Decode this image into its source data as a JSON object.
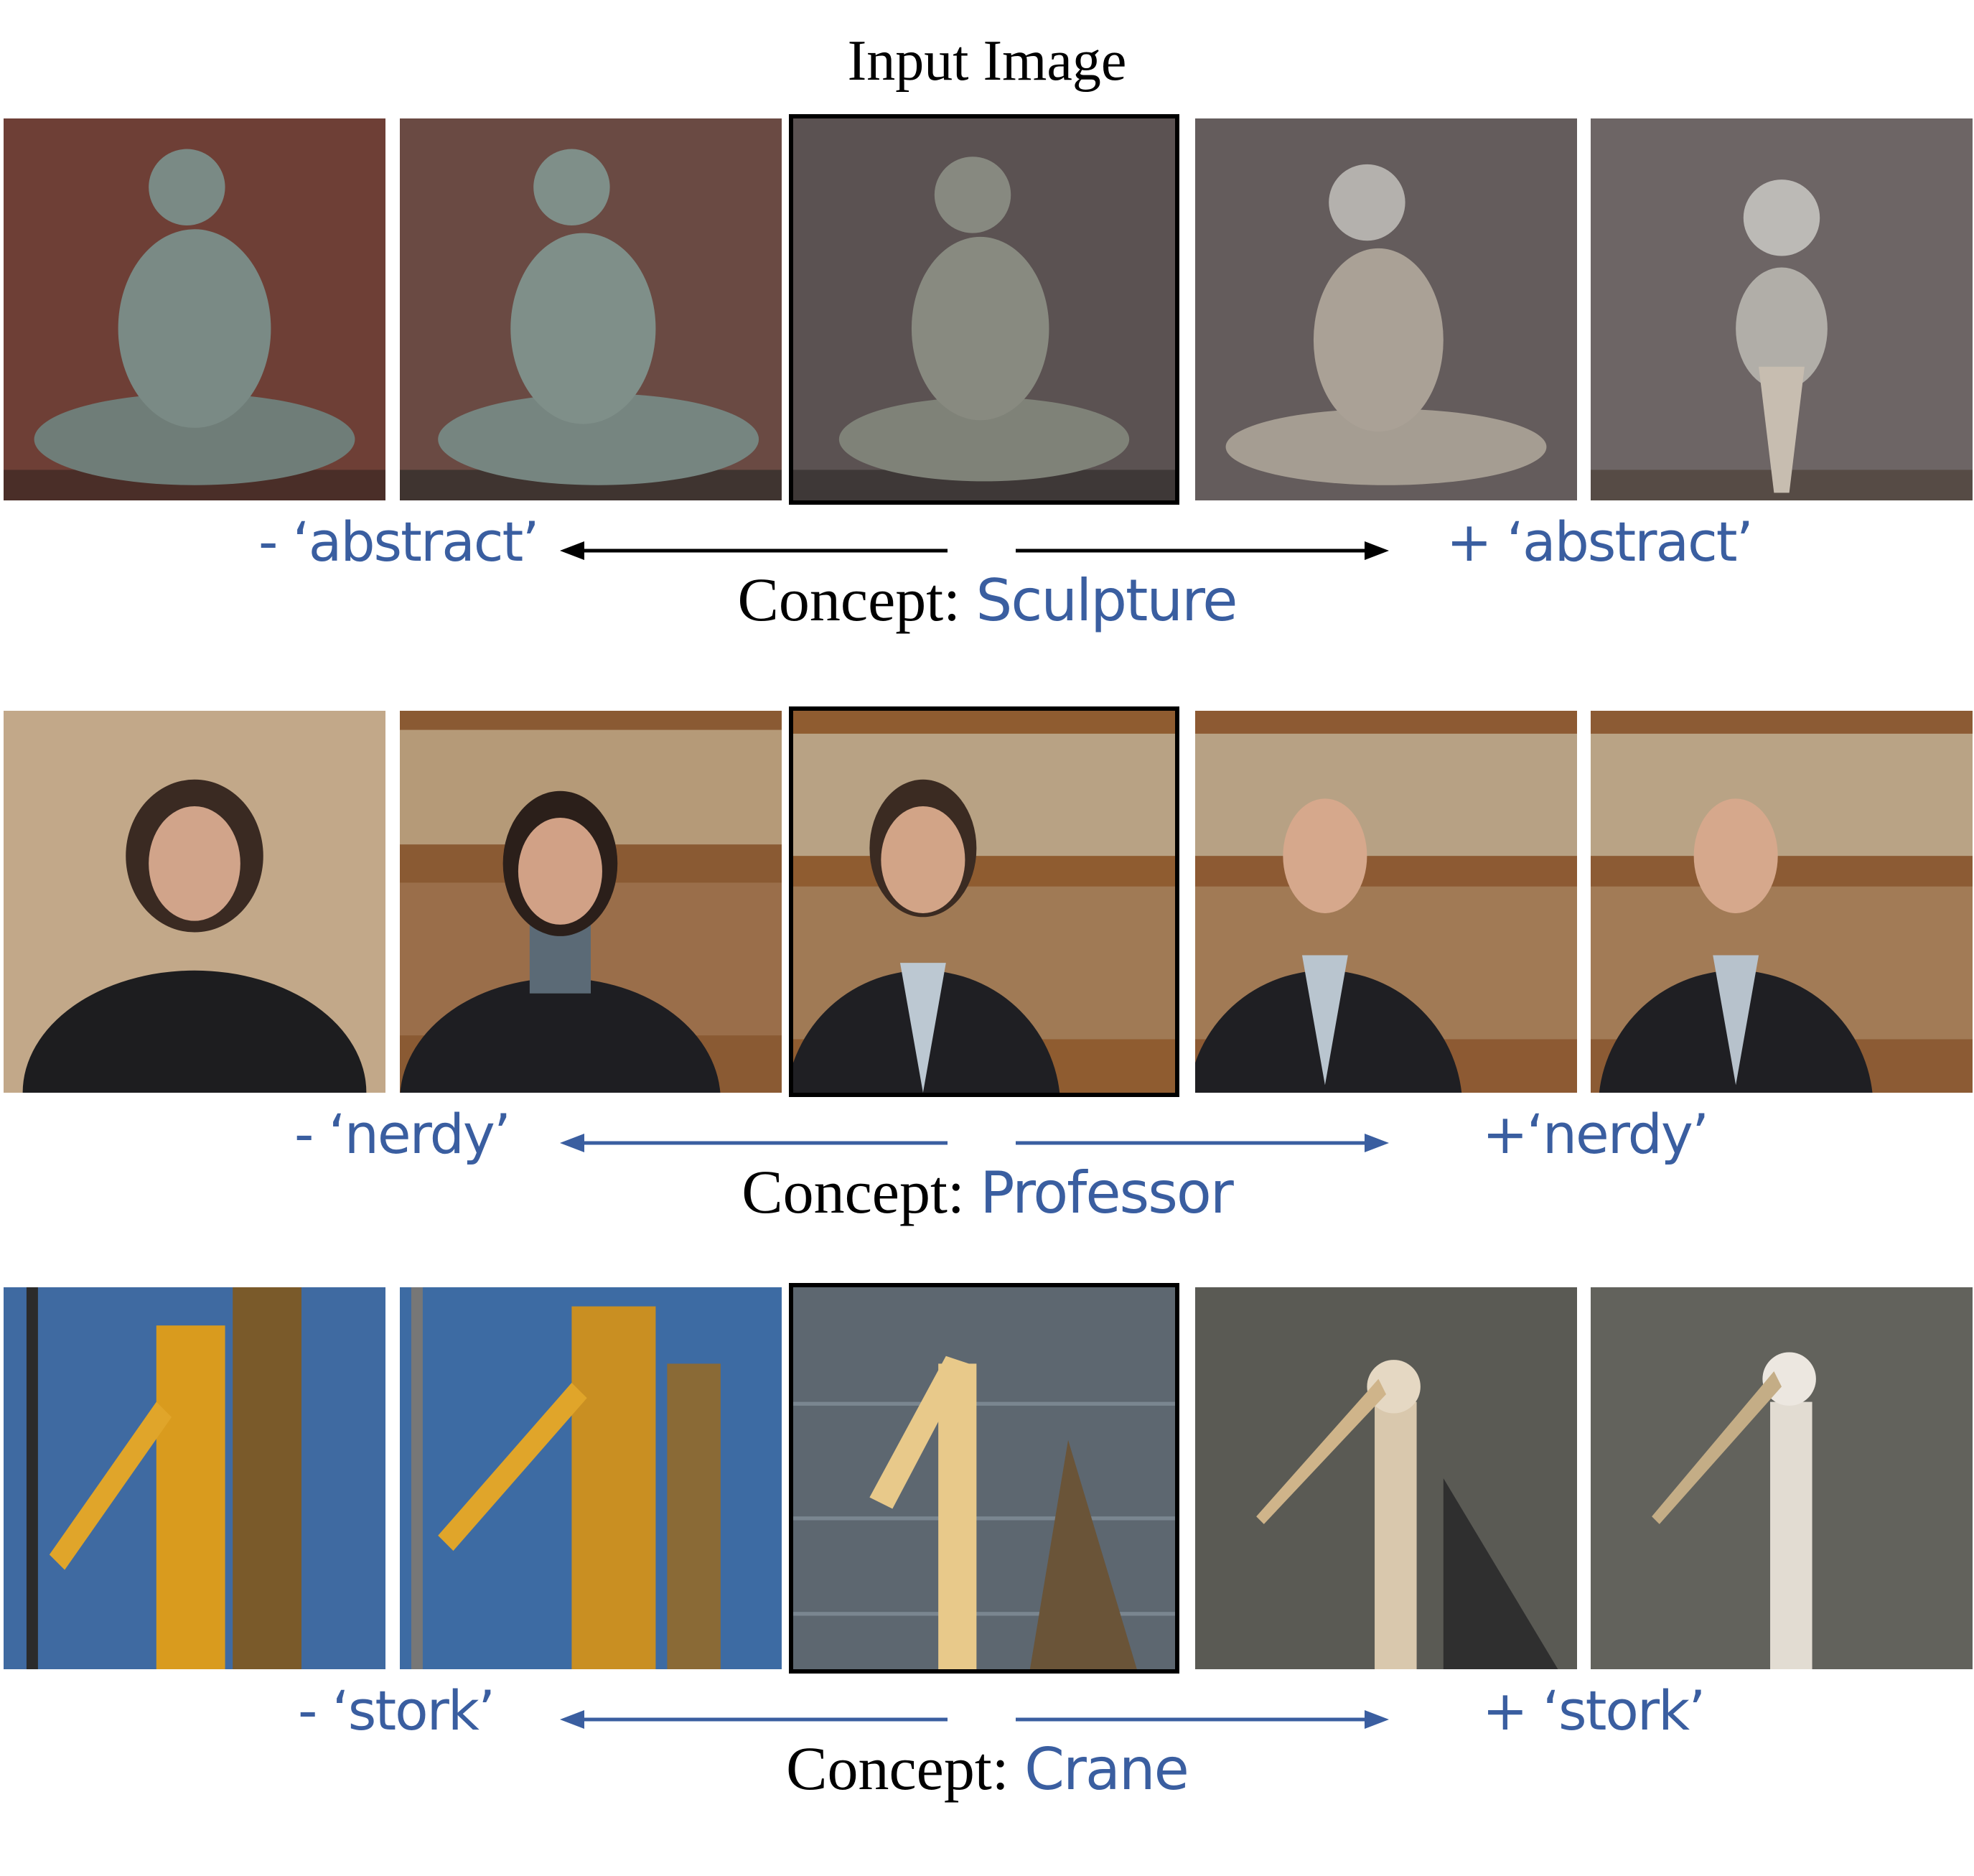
{
  "title": "Input Image",
  "rows": [
    {
      "left_label": "- ‘abstract’",
      "right_label": "+ ‘abstract’",
      "concept_prefix": "Concept:",
      "concept_value": "Sculpture",
      "arrow_color": "#000000"
    },
    {
      "left_label": "- ‘nerdy’",
      "right_label": "+‘nerdy’",
      "concept_prefix": "Concept:",
      "concept_value": "Professor",
      "arrow_color": "#3a5ea0"
    },
    {
      "left_label": "- ‘stork’",
      "right_label": "+ ‘stork’",
      "concept_prefix": "Concept:",
      "concept_value": "Crane",
      "arrow_color": "#3a5ea0"
    }
  ],
  "colors": {
    "accent": "#3a5ea0",
    "text": "#000000"
  }
}
